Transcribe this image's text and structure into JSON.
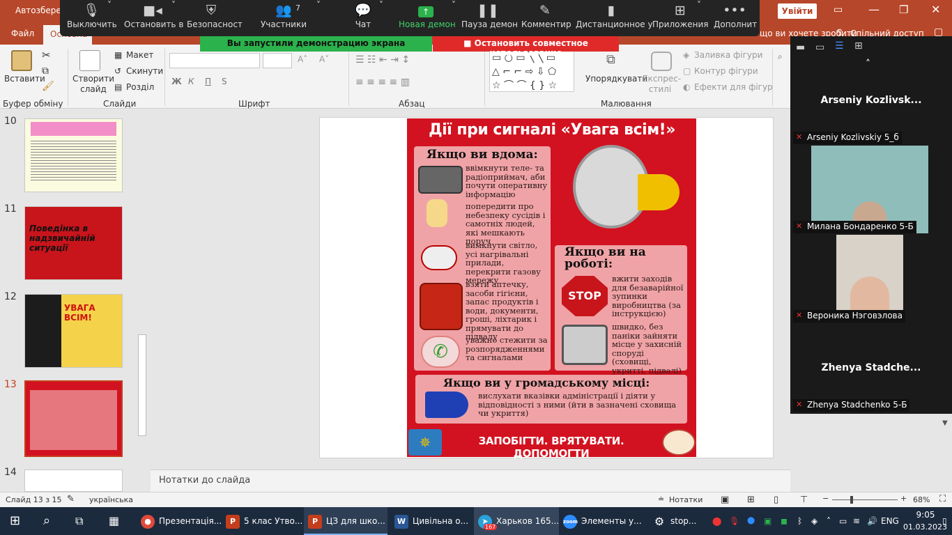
{
  "window": {
    "title_fragment": "Автозбереж",
    "sign_in": "Увійти",
    "tell_me_fragment": "що ви хочете зробити",
    "share": "Спільний доступ"
  },
  "tabs": {
    "file": "Файл",
    "home": "Основна"
  },
  "zoom": {
    "mute": "Выключить",
    "stop_video": "Остановить в",
    "security": "Безопасност",
    "participants": "Участники",
    "participants_count": "7",
    "chat": "Чат",
    "new_share": "Новая демон",
    "pause_share": "Пауза демон",
    "annotate": "Комментир",
    "remote": "Дистанционное у",
    "apps": "Приложения",
    "more": "Дополнит",
    "sharing_banner": "Вы запустили демонстрацию экрана",
    "stop_share": "Остановить совместное использование"
  },
  "ribbon": {
    "paste": "Вставити",
    "clipboard": "Буфер обміну",
    "new_slide": "Створити слайд",
    "layout": "Макет",
    "reset": "Скинути",
    "section": "Розділ",
    "slides": "Слайди",
    "font": "Шрифт",
    "paragraph": "Абзац",
    "arrange": "Упорядкувати",
    "quick_styles": "Експрес-стилі",
    "shape_fill": "Заливка фігури",
    "shape_outline": "Контур фігури",
    "shape_effects": "Ефекти для фігур",
    "drawing": "Малювання",
    "bold": "Ж",
    "italic": "К",
    "underline": "П",
    "strike": "S"
  },
  "slides_pane": {
    "items": [
      {
        "num": "10"
      },
      {
        "num": "11",
        "title": "Поведінка в надзвичайній ситуації"
      },
      {
        "num": "12",
        "title": "УВАГА ВСІМ!"
      },
      {
        "num": "13"
      },
      {
        "num": "14"
      }
    ]
  },
  "slide": {
    "title": "Дії при сигналі «Увага всім!»",
    "home_head": "Якщо ви вдома:",
    "home_items": [
      "ввімкнути теле- та радіоприймач, аби почути оперативну інформацію",
      "попередити про небезпеку сусідів і самотніх людей, які мешкають поруч",
      "вимкнути світло, усі нагрівальні прилади, перекрити газову мережу",
      "взяти аптечку, засоби гігієни, запас продуктів і води, документи, гроші, ліхтарик і прямувати до підвалу",
      "уважно стежити за розпорядженнями та сигналами"
    ],
    "work_head": "Якщо ви на роботі:",
    "work_items": [
      "вжити заходів для безаварійної зупинки виробництва (за інструкцією)",
      "швидко, без паніки зайняти місце у захисній споруді (сховищі, укритті, підвалі)"
    ],
    "public_head": "Якщо ви у громадському місці:",
    "public_item": "вислухати вказівки адміністрації і діяти у відповідності з ними (йти в зазначені сховища чи укриття)",
    "stop_sign": "STOP",
    "footer": "ЗАПОБІГТИ. ВРЯТУВАТИ. ДОПОМОГТИ"
  },
  "notes_placeholder": "Нотатки до слайда",
  "gallery": {
    "tiles": [
      {
        "name": "Arseniy  Kozlivsk...",
        "label": "Arseniy Kozlivskiy 5_б"
      },
      {
        "label": "Милана Бондаренко 5-Б"
      },
      {
        "label": "Вероника Нэговэлова"
      },
      {
        "name": "Zhenya  Stadche...",
        "label": "Zhenya Stadchenko 5-Б"
      }
    ]
  },
  "status": {
    "slide_of": "Слайд 13 з 15",
    "language": "українська",
    "notes": "Нотатки",
    "zoom": "68%"
  },
  "taskbar": {
    "apps": [
      {
        "label": "Презентація..."
      },
      {
        "label": "5 клас Утво..."
      },
      {
        "label": "ЦЗ для шко..."
      },
      {
        "label": "Цивільна о..."
      },
      {
        "label": "Харьков 165...",
        "badge": "167"
      },
      {
        "label": "Элементы у..."
      },
      {
        "label": "stop..."
      }
    ],
    "lang": "ENG",
    "time": "9:05",
    "date": "01.03.2023"
  },
  "colors": {
    "ppt_accent": "#b7472a",
    "poster_red": "#d21220",
    "zoom_green": "#2bb24c",
    "zoom_red": "#e02a2a"
  }
}
